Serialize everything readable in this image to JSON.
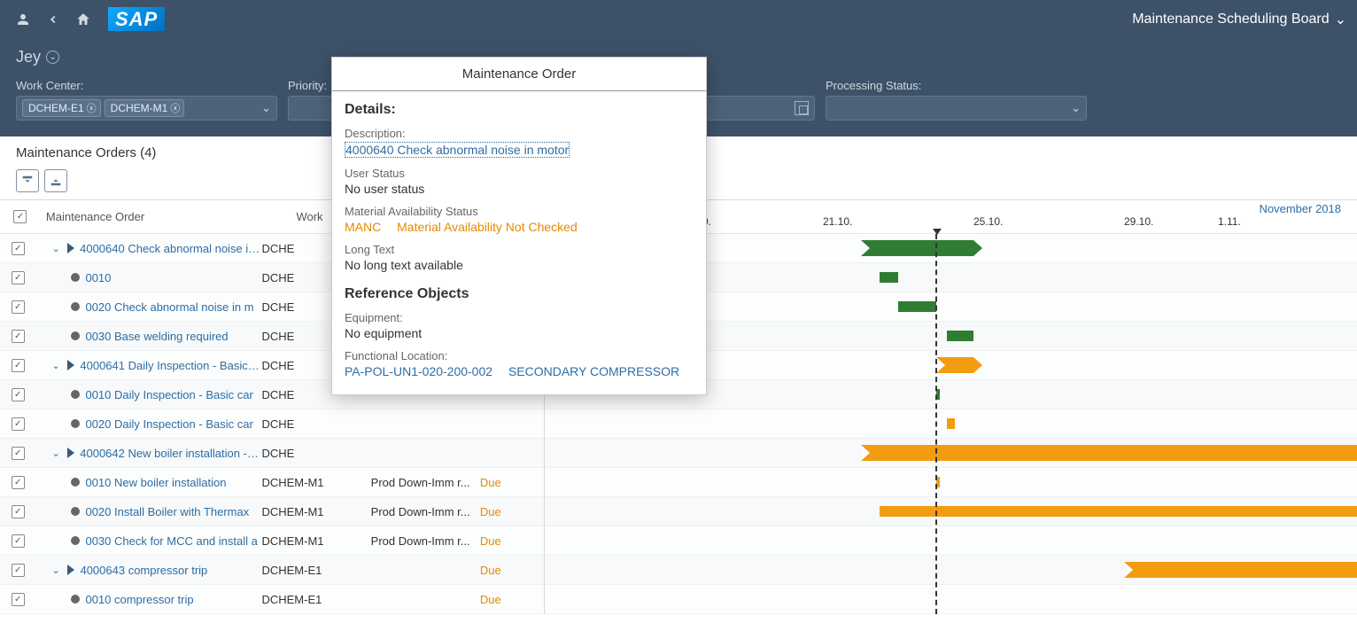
{
  "header": {
    "title": "Maintenance Scheduling Board"
  },
  "subheader": {
    "variant": "Jey"
  },
  "filters": {
    "work_center": {
      "label": "Work Center:",
      "tokens": [
        "DCHEM-E1",
        "DCHEM-M1"
      ]
    },
    "priority": {
      "label": "Priority:"
    },
    "processing_status": {
      "label": "Processing Status:"
    }
  },
  "table": {
    "title": "Maintenance Orders (4)",
    "columns": {
      "mo": "Maintenance Order",
      "wc": "Work"
    }
  },
  "timeline": {
    "month": "November 2018",
    "ticks": [
      {
        "label": "0.",
        "pos": 178
      },
      {
        "label": "21.10.",
        "pos": 314
      },
      {
        "label": "25.10.",
        "pos": 484
      },
      {
        "label": "29.10.",
        "pos": 654
      },
      {
        "label": "1.11.",
        "pos": 760
      }
    ],
    "now": 441
  },
  "rows": [
    {
      "type": "header",
      "mo": "4000640 Check abnormal noise in m",
      "wc": "DCHE"
    },
    {
      "type": "child",
      "mo": "0010",
      "wc": "DCHE"
    },
    {
      "type": "child",
      "mo": "0020 Check abnormal noise in m",
      "wc": "DCHE"
    },
    {
      "type": "child",
      "mo": "0030 Base welding required",
      "wc": "DCHE"
    },
    {
      "type": "header",
      "mo": "4000641 Daily Inspection - Basic ca",
      "wc": "DCHE"
    },
    {
      "type": "child",
      "mo": "0010 Daily Inspection - Basic car",
      "wc": "DCHE"
    },
    {
      "type": "child",
      "mo": "0020 Daily Inspection - Basic car",
      "wc": "DCHE"
    },
    {
      "type": "header",
      "mo": "4000642 New boiler installation - Re",
      "wc": "DCHE"
    },
    {
      "type": "child",
      "mo": "0010 New boiler installation",
      "wc": "DCHEM-M1",
      "pr": "Prod Down-Imm r...",
      "due": "Due"
    },
    {
      "type": "child",
      "mo": "0020 Install Boiler with Thermax",
      "wc": "DCHEM-M1",
      "pr": "Prod Down-Imm r...",
      "due": "Due"
    },
    {
      "type": "child",
      "mo": "0030 Check for MCC and install a",
      "wc": "DCHEM-M1",
      "pr": "Prod Down-Imm r...",
      "due": "Due"
    },
    {
      "type": "header",
      "mo": "4000643 compressor trip",
      "wc": "DCHEM-E1",
      "due": "Due"
    },
    {
      "type": "child",
      "mo": "0010 compressor trip",
      "wc": "DCHEM-E1",
      "due": "Due"
    }
  ],
  "popover": {
    "title": "Maintenance Order",
    "details_header": "Details:",
    "description_label": "Description:",
    "description_link": "4000640 Check abnormal noise in motor",
    "user_status_label": "User Status",
    "user_status_value": "No user status",
    "mat_avail_label": "Material Availability Status",
    "mat_avail_code": "MANC",
    "mat_avail_text": "Material Availability Not Checked",
    "long_text_label": "Long Text",
    "long_text_value": "No long text available",
    "ref_header": "Reference Objects",
    "equipment_label": "Equipment:",
    "equipment_value": "No equipment",
    "floc_label": "Functional Location:",
    "floc_code": "PA-POL-UN1-020-200-002",
    "floc_text": "SECONDARY COMPRESSOR"
  },
  "chart_data": {
    "type": "gantt",
    "time_axis": {
      "start": "2018-10-17",
      "end": "2018-11-02",
      "now": "2018-10-24"
    },
    "tasks": [
      {
        "row": 0,
        "name": "4000640",
        "start": "2018-10-22",
        "end": "2018-10-25",
        "color": "green",
        "shape": "arrow"
      },
      {
        "row": 1,
        "name": "0010",
        "start": "2018-10-22.5",
        "end": "2018-10-23",
        "color": "green",
        "shape": "bar"
      },
      {
        "row": 2,
        "name": "0020",
        "start": "2018-10-23",
        "end": "2018-10-24",
        "color": "green",
        "shape": "bar"
      },
      {
        "row": 3,
        "name": "0030",
        "start": "2018-10-24.3",
        "end": "2018-10-25",
        "color": "green",
        "shape": "bar"
      },
      {
        "row": 4,
        "name": "4000641",
        "start": "2018-10-24",
        "end": "2018-10-25",
        "color": "orange",
        "shape": "arrow"
      },
      {
        "row": 5,
        "name": "0010",
        "start": "2018-10-24",
        "end": "2018-10-24.1",
        "color": "green",
        "shape": "bar"
      },
      {
        "row": 6,
        "name": "0020",
        "start": "2018-10-24.3",
        "end": "2018-10-24.5",
        "color": "orange",
        "shape": "bar"
      },
      {
        "row": 7,
        "name": "4000642",
        "start": "2018-10-22",
        "end": "2018-11-02+",
        "color": "orange",
        "shape": "arrow"
      },
      {
        "row": 8,
        "name": "0010",
        "start": "2018-10-24",
        "end": "2018-10-24.1",
        "color": "orange",
        "shape": "bar"
      },
      {
        "row": 9,
        "name": "0020",
        "start": "2018-10-22.5",
        "end": "2018-11-02+",
        "color": "orange",
        "shape": "bar"
      },
      {
        "row": 11,
        "name": "4000643",
        "start": "2018-10-29",
        "end": "2018-11-02+",
        "color": "orange",
        "shape": "arrow"
      }
    ]
  }
}
